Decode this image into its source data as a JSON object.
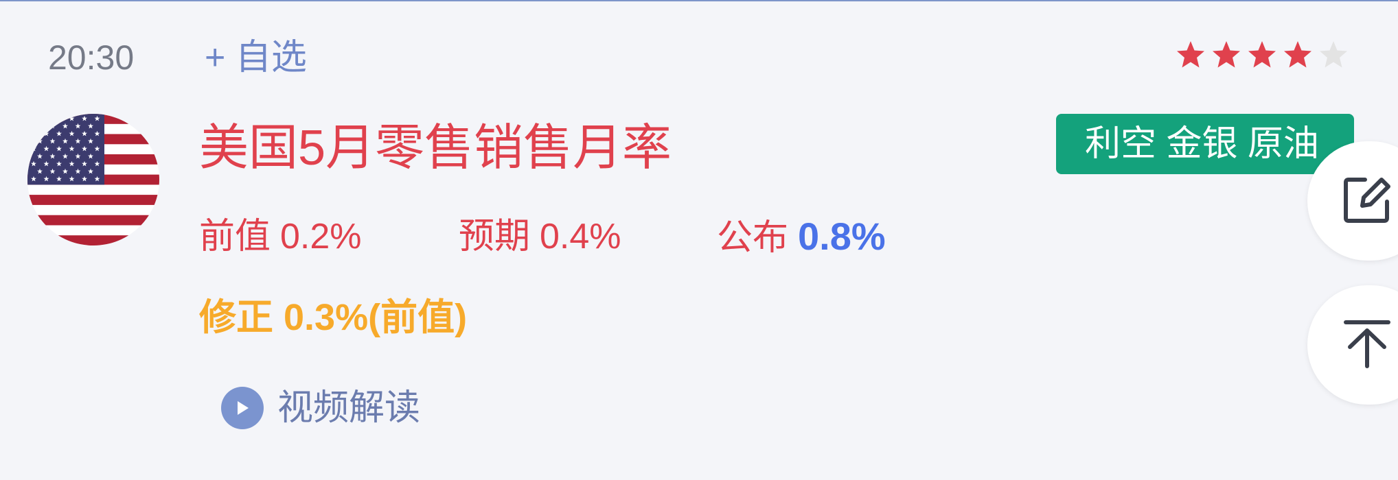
{
  "event": {
    "time": "20:30",
    "add_watchlist_label": "+ 自选",
    "title": "美国5月零售销售月率",
    "country_flag_icon": "us-flag-icon",
    "importance_stars": 4,
    "importance_max": 5,
    "impact_badge": "利空 金银 原油",
    "previous": {
      "label": "前值",
      "value": "0.2%"
    },
    "forecast": {
      "label": "预期",
      "value": "0.4%"
    },
    "actual": {
      "label": "公布",
      "value": "0.8%"
    },
    "revision": "修正 0.3%(前值)",
    "video_label": "视频解读"
  },
  "floating_actions": {
    "edit_icon": "edit-icon",
    "back_to_top_icon": "back-to-top-icon"
  },
  "colors": {
    "title_red": "#e0414d",
    "actual_blue": "#4a72e8",
    "revision_orange": "#f7aa2b",
    "badge_green": "#14a27c",
    "star_filled": "#e0414d",
    "star_empty": "#e3e3e3",
    "link_blue": "#6f87c8"
  }
}
